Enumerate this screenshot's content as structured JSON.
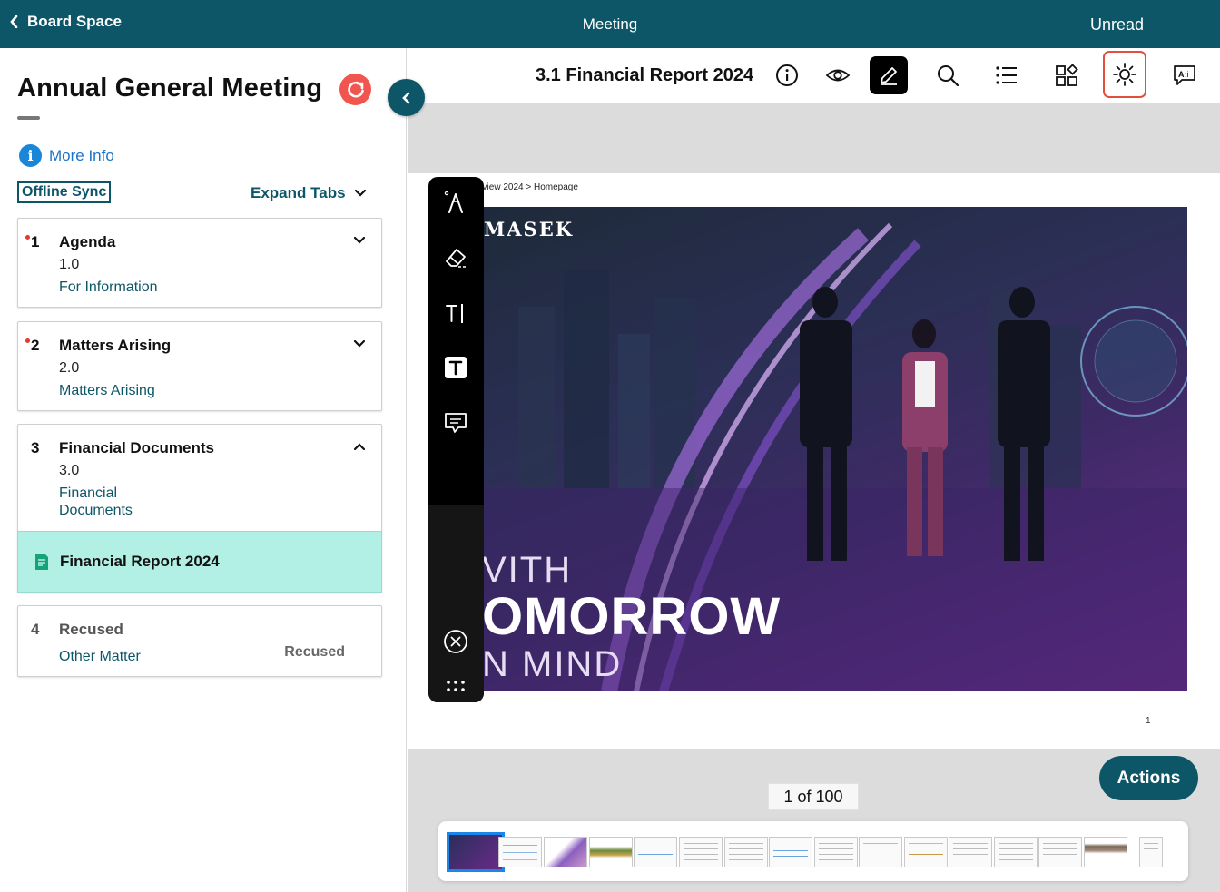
{
  "topbar": {
    "back_label": "Board Space",
    "center_label": "Meeting",
    "right_label": "Unread"
  },
  "sidebar": {
    "meeting_title": "Annual General Meeting",
    "more_info": "More Info",
    "offline_sync": "Offline Sync",
    "expand_tabs": "Expand Tabs",
    "items": [
      {
        "number": "1",
        "title": "Agenda",
        "code": "1.0",
        "category": "For Information",
        "unread": true,
        "expanded": false
      },
      {
        "number": "2",
        "title": "Matters Arising",
        "code": "2.0",
        "category": "Matters Arising",
        "unread": true,
        "expanded": false
      },
      {
        "number": "3",
        "title": "Financial Documents",
        "code": "3.0",
        "category_line1": "Financial",
        "category_line2": "Documents",
        "unread": false,
        "expanded": true,
        "sub_item": "Financial Report 2024"
      },
      {
        "number": "4",
        "title": "Recused",
        "category": "Other Matter",
        "status": "Recused"
      }
    ]
  },
  "document": {
    "title": "3.1 Financial Report 2024",
    "breadcrumb": "eview 2024 > Homepage",
    "brand": "MASEK",
    "headline_line1": "VITH",
    "headline_line2": "OMORROW",
    "headline_line3": "N MIND",
    "page_number_printed": "1",
    "pager": "1 of 100",
    "actions_label": "Actions"
  },
  "toolbar_icons": [
    "info-icon",
    "eye-icon",
    "pencil-icon",
    "search-icon",
    "list-icon",
    "apps-icon",
    "brightness-icon",
    "ai-text-icon"
  ],
  "colors": {
    "brand": "#0d5668",
    "selected_item": "#b2f0e6",
    "refresh": "#f0554f",
    "highlight_outline": "#e0513d",
    "link": "#1a73c8"
  }
}
